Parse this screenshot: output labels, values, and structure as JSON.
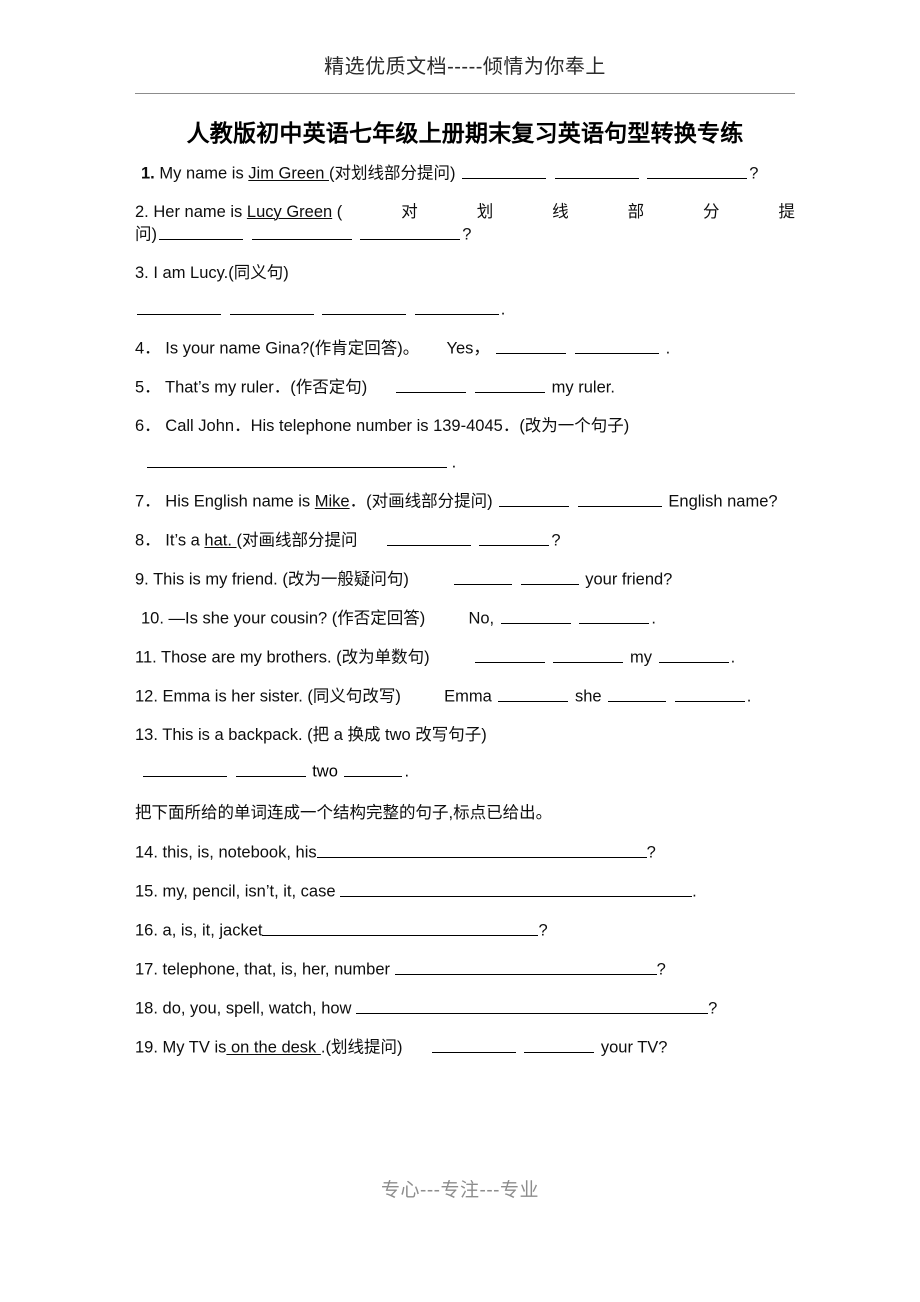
{
  "header": {
    "watermark_top": "精选优质文档-----倾情为你奉上",
    "watermark_bottom": "专心---专注---专业"
  },
  "title": "人教版初中英语七年级上册期末复习英语句型转换专练",
  "instruction": "把下面所给的单词连成一个结构完整的句子,标点已给出。",
  "items": [
    {
      "num": "1.",
      "text_before": "My name is ",
      "underlined": "Jim Green ",
      "text_after": "(对划线部分提问)",
      "trailing": "?"
    },
    {
      "num": "2.",
      "text_before": "Her name is ",
      "underlined": "Lucy Green",
      "paren_open": "(",
      "spread_chars": [
        "对",
        "划",
        "线",
        "部",
        "分",
        "提"
      ],
      "wrap_text": "问)",
      "trailing": "?"
    },
    {
      "num": "3.",
      "text": "I am Lucy.(同义句)",
      "answer_blanks": 4,
      "answer_end": "."
    },
    {
      "num": "4．",
      "text": "Is your name Gina?(作肯定回答)。",
      "answer_prefix": "Yes，",
      "answer_end": "."
    },
    {
      "num": "5．",
      "text": "That’s my ruler．(作否定句)",
      "answer_suffix": "my ruler."
    },
    {
      "num": "6．",
      "text": "Call John．His telephone number is 139-4045．(改为一个句子)",
      "answer_end": "."
    },
    {
      "num": "7．",
      "text_before": "His English name is ",
      "underlined": "Mike",
      "text_after": "．(对画线部分提问)",
      "answer_suffix": "English name?"
    },
    {
      "num": "8．",
      "text_before": "It’s a ",
      "underlined": "hat. ",
      "text_after": "(对画线部分提问",
      "trailing": "?"
    },
    {
      "num": "9.",
      "text": "This is my friend. (改为一般疑问句)",
      "answer_suffix": "your friend?"
    },
    {
      "num": "10.",
      "text": "—Is she your cousin? (作否定回答)",
      "answer_prefix": "No,",
      "answer_end": "."
    },
    {
      "num": "11.",
      "text": "Those are my brothers. (改为单数句)",
      "answer_mid": "my",
      "answer_end": "."
    },
    {
      "num": "12.",
      "text": "Emma is her sister. (同义句改写)",
      "answer_prefix": "Emma",
      "answer_mid": "she",
      "answer_end": "."
    },
    {
      "num": "13.",
      "text": "This is a backpack. (把 a 换成 two 改写句子)",
      "answer_mid": "two",
      "answer_end": "."
    },
    {
      "num": "14.",
      "text": "this, is, notebook, his",
      "trailing": "?"
    },
    {
      "num": "15.",
      "text": "my, pencil, isn’t, it, case ",
      "trailing": "."
    },
    {
      "num": "16.",
      "text": "a, is, it, jacket",
      "trailing": "?"
    },
    {
      "num": "17.",
      "text": "telephone, that, is, her, number ",
      "trailing": "?"
    },
    {
      "num": "18.",
      "text": "do, you, spell, watch, how ",
      "trailing": "?"
    },
    {
      "num": "19.",
      "text_before": "My TV is",
      "underlined": " on the desk ",
      "text_after": ".(划线提问)",
      "answer_suffix": "your TV?"
    }
  ]
}
